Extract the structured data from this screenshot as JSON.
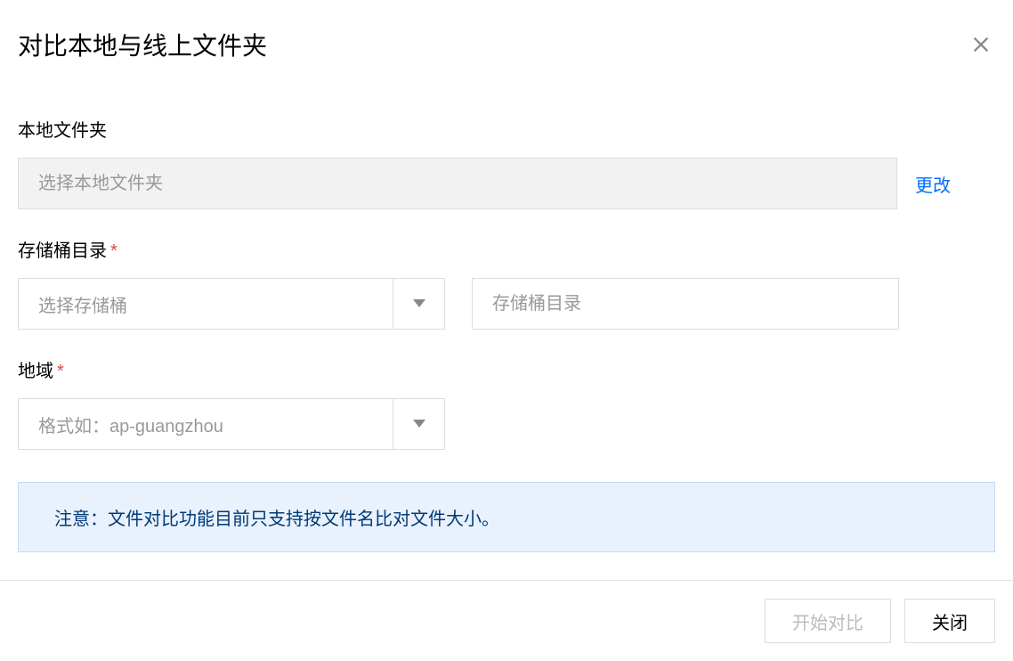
{
  "dialog": {
    "title": "对比本地与线上文件夹"
  },
  "localFolder": {
    "label": "本地文件夹",
    "placeholder": "选择本地文件夹",
    "changeLink": "更改"
  },
  "bucketDir": {
    "label": "存储桶目录",
    "selectPlaceholder": "选择存储桶",
    "inputPlaceholder": "存储桶目录"
  },
  "region": {
    "label": "地域",
    "placeholder": "格式如：ap-guangzhou"
  },
  "notice": {
    "text": "注意：文件对比功能目前只支持按文件名比对文件大小。"
  },
  "footer": {
    "startCompare": "开始对比",
    "close": "关闭"
  }
}
